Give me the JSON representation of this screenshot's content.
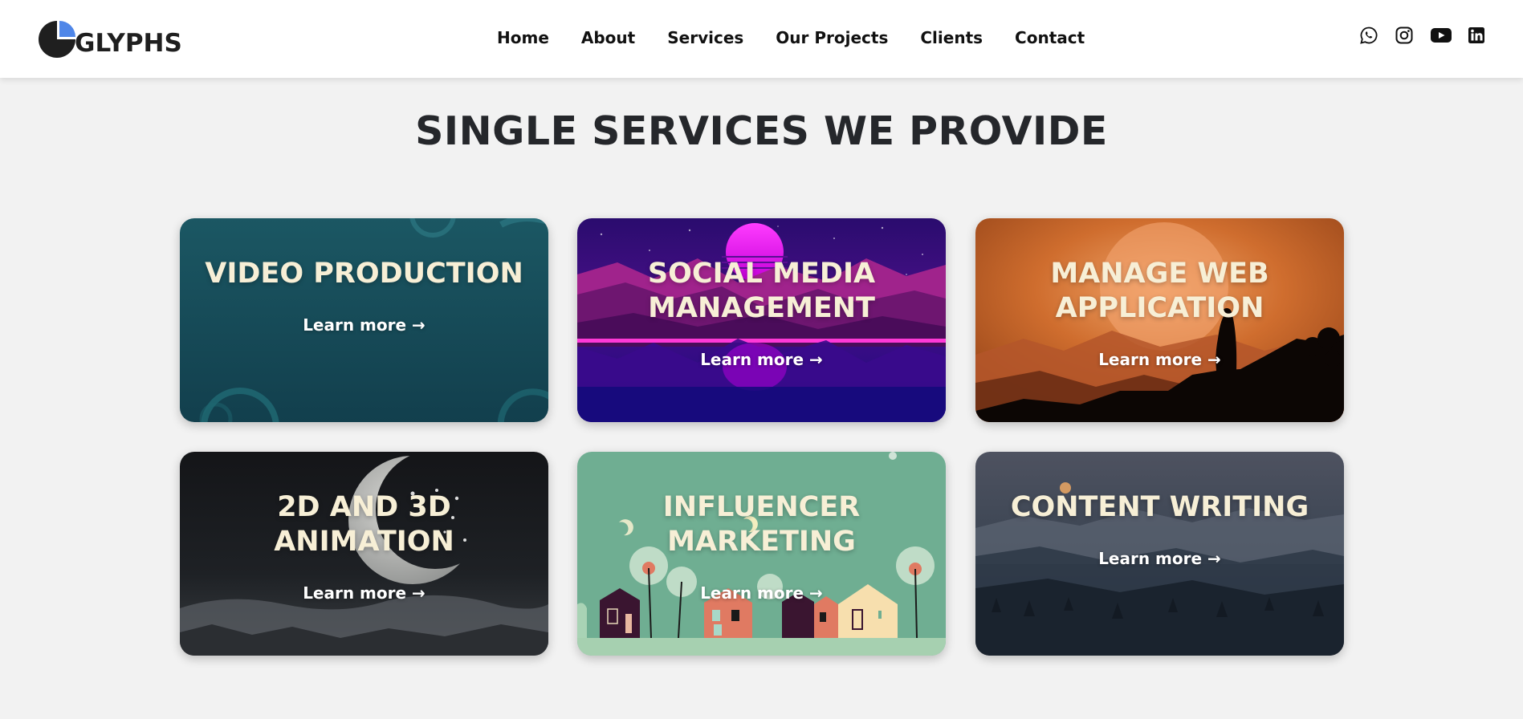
{
  "brand": {
    "logo_text": "GLYPHS"
  },
  "nav": {
    "items": [
      {
        "label": "Home"
      },
      {
        "label": "About"
      },
      {
        "label": "Services"
      },
      {
        "label": "Our Projects"
      },
      {
        "label": "Clients"
      },
      {
        "label": "Contact"
      }
    ]
  },
  "social": {
    "icons": [
      "whatsapp-icon",
      "instagram-icon",
      "youtube-icon",
      "linkedin-icon"
    ]
  },
  "section": {
    "title": "SINGLE SERVICES WE PROVIDE"
  },
  "services": [
    {
      "title": "VIDEO PRODUCTION",
      "link": "Learn more →"
    },
    {
      "title": "SOCIAL MEDIA MANAGEMENT",
      "link": "Learn more →"
    },
    {
      "title": "MANAGE WEB APPLICATION",
      "link": "Learn more →"
    },
    {
      "title": "2D AND 3D ANIMATION",
      "link": "Learn more →"
    },
    {
      "title": "INFLUENCER MARKETING",
      "link": "Learn more →"
    },
    {
      "title": "CONTENT WRITING",
      "link": "Learn more →"
    }
  ],
  "colors": {
    "page_bg": "#f2f2f2",
    "header_bg": "#ffffff",
    "title_text": "#25272b",
    "card_title": "#f7efd6",
    "logo_accent": "#4f86e8"
  }
}
